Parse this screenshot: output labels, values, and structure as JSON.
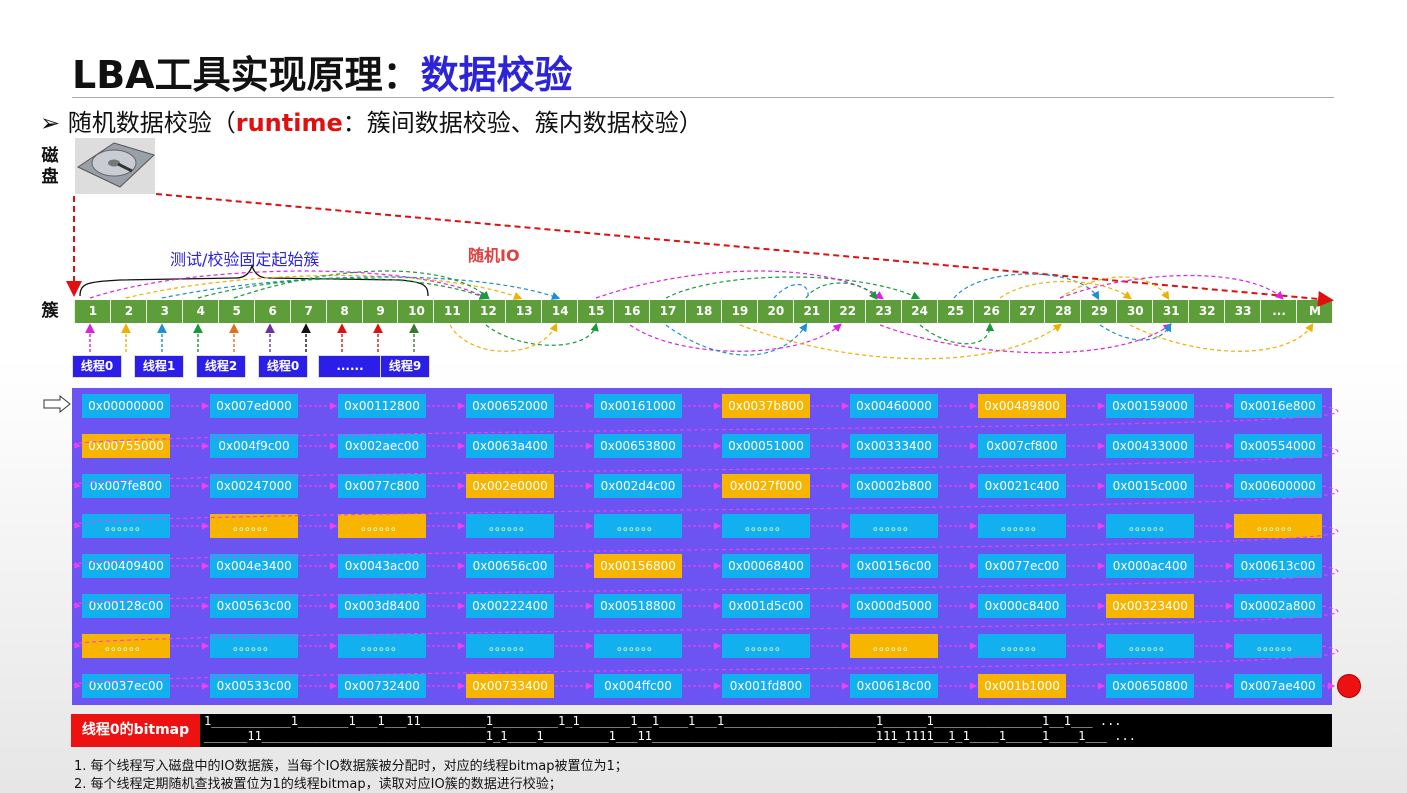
{
  "title": {
    "prefix": "LBA工具实现原理：",
    "highlight": "数据校验"
  },
  "bullet": {
    "marker": "➢",
    "text1": "随机数据校验（",
    "runtime": "runtime",
    "text2": "：簇间数据校验、簇内数据校验）"
  },
  "labels": {
    "disk": "磁\n盘",
    "cluster": "簇",
    "fixed_start": "测试/校验固定起始簇",
    "random_io": "随机IO"
  },
  "clusters": [
    "1",
    "2",
    "3",
    "4",
    "5",
    "6",
    "7",
    "8",
    "9",
    "10",
    "11",
    "12",
    "13",
    "14",
    "15",
    "16",
    "17",
    "18",
    "19",
    "20",
    "21",
    "22",
    "23",
    "24",
    "25",
    "26",
    "27",
    "28",
    "29",
    "30",
    "31",
    "32",
    "33",
    "...",
    "M"
  ],
  "threads": [
    "线程0",
    "线程1",
    "线程2",
    "线程0",
    "......",
    "线程9"
  ],
  "grid": [
    [
      [
        "0x00000000",
        "b"
      ],
      [
        "0x007ed000",
        "b"
      ],
      [
        "0x00112800",
        "b"
      ],
      [
        "0x00652000",
        "b"
      ],
      [
        "0x00161000",
        "b"
      ],
      [
        "0x0037b800",
        "y"
      ],
      [
        "0x00460000",
        "b"
      ],
      [
        "0x00489800",
        "y"
      ],
      [
        "0x00159000",
        "b"
      ],
      [
        "0x0016e800",
        "b"
      ]
    ],
    [
      [
        "0x00755000",
        "y"
      ],
      [
        "0x004f9c00",
        "b"
      ],
      [
        "0x002aec00",
        "b"
      ],
      [
        "0x0063a400",
        "b"
      ],
      [
        "0x00653800",
        "b"
      ],
      [
        "0x00051000",
        "b"
      ],
      [
        "0x00333400",
        "b"
      ],
      [
        "0x007cf800",
        "b"
      ],
      [
        "0x00433000",
        "b"
      ],
      [
        "0x00554000",
        "b"
      ]
    ],
    [
      [
        "0x007fe800",
        "b"
      ],
      [
        "0x00247000",
        "b"
      ],
      [
        "0x0077c800",
        "b"
      ],
      [
        "0x002e0000",
        "y"
      ],
      [
        "0x002d4c00",
        "b"
      ],
      [
        "0x0027f000",
        "y"
      ],
      [
        "0x0002b800",
        "b"
      ],
      [
        "0x0021c400",
        "b"
      ],
      [
        "0x0015c000",
        "b"
      ],
      [
        "0x00600000",
        "b"
      ]
    ],
    [
      [
        "。。。。。。",
        "b"
      ],
      [
        "。。。。。。",
        "y"
      ],
      [
        "。。。。。。",
        "y"
      ],
      [
        "。。。。。。",
        "b"
      ],
      [
        "。。。。。。",
        "b"
      ],
      [
        "。。。。。。",
        "b"
      ],
      [
        "。。。。。。",
        "b"
      ],
      [
        "。。。。。。",
        "b"
      ],
      [
        "。。。。。。",
        "b"
      ],
      [
        "。。。。。。",
        "y"
      ]
    ],
    [
      [
        "0x00409400",
        "b"
      ],
      [
        "0x004e3400",
        "b"
      ],
      [
        "0x0043ac00",
        "b"
      ],
      [
        "0x00656c00",
        "b"
      ],
      [
        "0x00156800",
        "y"
      ],
      [
        "0x00068400",
        "b"
      ],
      [
        "0x00156c00",
        "b"
      ],
      [
        "0x0077ec00",
        "b"
      ],
      [
        "0x000ac400",
        "b"
      ],
      [
        "0x00613c00",
        "b"
      ]
    ],
    [
      [
        "0x00128c00",
        "b"
      ],
      [
        "0x00563c00",
        "b"
      ],
      [
        "0x003d8400",
        "b"
      ],
      [
        "0x00222400",
        "b"
      ],
      [
        "0x00518800",
        "b"
      ],
      [
        "0x001d5c00",
        "b"
      ],
      [
        "0x000d5000",
        "b"
      ],
      [
        "0x000c8400",
        "b"
      ],
      [
        "0x00323400",
        "y"
      ],
      [
        "0x0002a800",
        "b"
      ]
    ],
    [
      [
        "。。。。。。",
        "y"
      ],
      [
        "。。。。。。",
        "b"
      ],
      [
        "。。。。。。",
        "b"
      ],
      [
        "。。。。。。",
        "b"
      ],
      [
        "。。。。。。",
        "b"
      ],
      [
        "。。。。。。",
        "b"
      ],
      [
        "。。。。。。",
        "y"
      ],
      [
        "。。。。。。",
        "b"
      ],
      [
        "。。。。。。",
        "b"
      ],
      [
        "。。。。。。",
        "b"
      ]
    ],
    [
      [
        "0x0037ec00",
        "b"
      ],
      [
        "0x00533c00",
        "b"
      ],
      [
        "0x00732400",
        "b"
      ],
      [
        "0x00733400",
        "y"
      ],
      [
        "0x004ffc00",
        "b"
      ],
      [
        "0x001fd800",
        "b"
      ],
      [
        "0x00618c00",
        "b"
      ],
      [
        "0x001b1000",
        "y"
      ],
      [
        "0x00650800",
        "b"
      ],
      [
        "0x007ae400",
        "b"
      ]
    ]
  ],
  "bitmap": {
    "label": "线程0的bitmap",
    "line1": "1___________1_______1___1___11_________1_________1_1_______1__1____1___1_____________________1______1_______________1__1___ ...",
    "line2": "______11_______________________________1_1____1_________1___11_______________________________111_1111__1_1____1_____1____1___ ..."
  },
  "notes": [
    "1. 每个线程写入磁盘中的IO数据簇，当每个IO数据簇被分配时，对应的线程bitmap被置位为1；",
    "2. 每个线程定期随机查找被置位为1的线程bitmap，读取对应IO簇的数据进行校验；"
  ],
  "colors": {
    "blue_cell": "#12b0ee",
    "yellow_cell": "#f7b500",
    "grid_bg": "#6b54f2",
    "cluster_bg": "#5e9e3a",
    "title_highlight": "#2d24d8"
  }
}
